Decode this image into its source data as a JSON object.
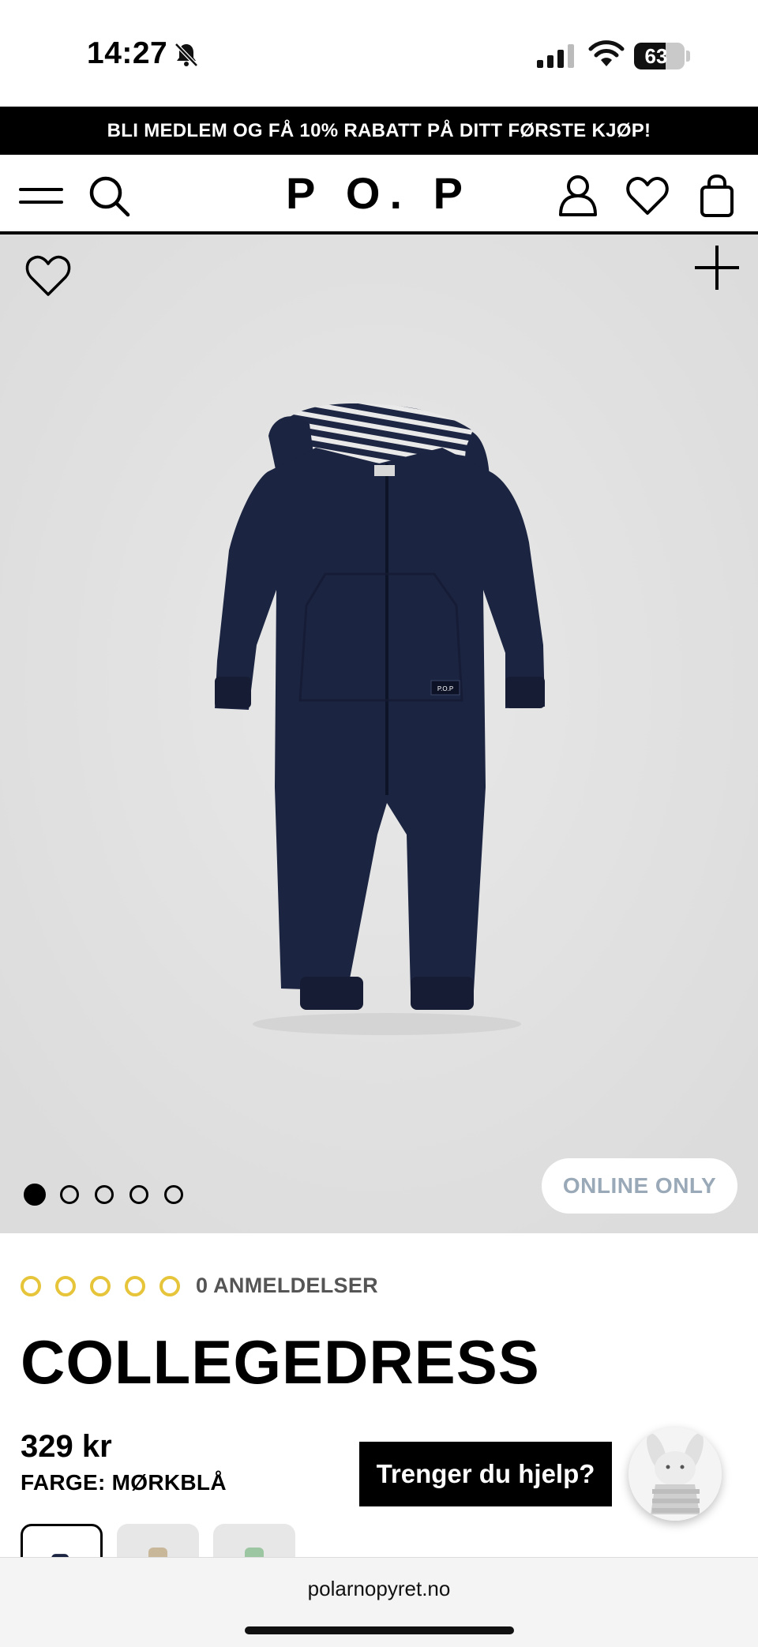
{
  "status_bar": {
    "time": "14:27",
    "battery": "63",
    "battery_level": 0.63
  },
  "promo": {
    "text": "BLI MEDLEM OG FÅ 10% RABATT PÅ DITT FØRSTE KJØP!"
  },
  "header": {
    "logo": "P O. P",
    "icons": [
      "menu-icon",
      "search-icon",
      "user-icon",
      "heart-icon",
      "bag-icon"
    ]
  },
  "gallery": {
    "image_count": 5,
    "active_index": 0,
    "badge": "ONLINE ONLY",
    "garment_tag": "P.O.P"
  },
  "product": {
    "rating_stars": 5,
    "reviews": "0 ANMELDELSER",
    "title": "COLLEGEDRESS",
    "price": "329 kr",
    "color_label": "FARGE: MØRKBLÅ"
  },
  "help": {
    "label": "Trenger du hjelp?"
  },
  "browser": {
    "url": "polarnopyret.no"
  },
  "colors": {
    "accent_yellow": "#e7c53a",
    "navy": "#1b2440",
    "image_bg": "#e2e2e2",
    "badge_text": "#9aa9b8"
  }
}
